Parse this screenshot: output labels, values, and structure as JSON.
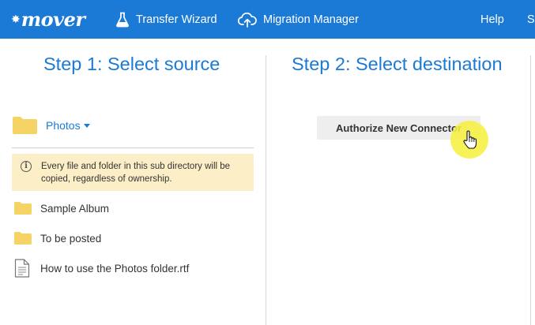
{
  "topbar": {
    "brand": "mover",
    "nav": [
      {
        "label": "Transfer Wizard",
        "icon": "flask-icon"
      },
      {
        "label": "Migration Manager",
        "icon": "cloud-upload-icon"
      }
    ],
    "help": "Help",
    "truncated_item": "S"
  },
  "colors": {
    "brand_blue": "#1a7ad6",
    "notice_bg": "#fcefc7",
    "folder_yellow": "#f5d465",
    "cursor_highlight": "#f7f042"
  },
  "source": {
    "title": "Step 1: Select source",
    "folder": {
      "name": "Photos",
      "icon": "folder-icon"
    },
    "notice": {
      "icon": "info-icon",
      "text": "Every file and folder in this sub directory will be copied, regardless of ownership."
    },
    "items": [
      {
        "name": "Sample Album",
        "icon": "folder-icon"
      },
      {
        "name": "To be posted",
        "icon": "folder-icon"
      },
      {
        "name": "How to use the Photos folder.rtf",
        "icon": "document-icon"
      }
    ]
  },
  "destination": {
    "title": "Step 2: Select destination",
    "authorize_button": "Authorize New Connector"
  }
}
